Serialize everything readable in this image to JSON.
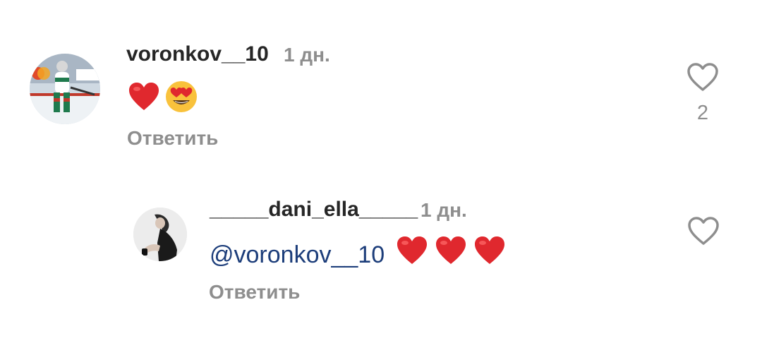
{
  "comments": [
    {
      "username": "voronkov__10",
      "time": "1 дн.",
      "reply_label": "Ответить",
      "likes": "2",
      "emojis": [
        "red-heart",
        "heart-eyes-face"
      ]
    }
  ],
  "replies": [
    {
      "username": "_____dani_ella_____",
      "time": "1 дн.",
      "mention": "@voronkov__10",
      "reply_label": "Ответить",
      "emojis": [
        "red-heart",
        "red-heart",
        "red-heart"
      ]
    }
  ],
  "colors": {
    "username": "#262626",
    "secondary": "#8e8e8e",
    "mention": "#1c3d7a",
    "heart": "#e0282e"
  }
}
